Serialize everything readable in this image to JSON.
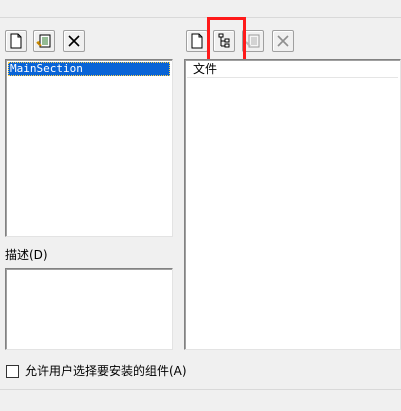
{
  "left_panel": {
    "toolbar": [
      {
        "icon": "new-page-icon",
        "enabled": true
      },
      {
        "icon": "properties-icon",
        "enabled": true
      },
      {
        "icon": "delete-icon",
        "enabled": true
      }
    ],
    "sections": [
      "MainSection"
    ],
    "selected_section": "MainSection",
    "description_label": "描述(D)",
    "description_text": ""
  },
  "right_panel": {
    "toolbar": [
      {
        "icon": "new-page-icon",
        "enabled": true
      },
      {
        "icon": "tree-structure-icon",
        "enabled": true,
        "highlighted": true
      },
      {
        "icon": "properties-icon",
        "enabled": false
      },
      {
        "icon": "delete-icon",
        "enabled": false
      }
    ],
    "files_header": "文件",
    "files": []
  },
  "allow_select_label": "允许用户选择要安装的组件(A)",
  "allow_select_checked": false,
  "colors": {
    "selection": "#0a64d6",
    "highlight": "#ff1a1a"
  }
}
